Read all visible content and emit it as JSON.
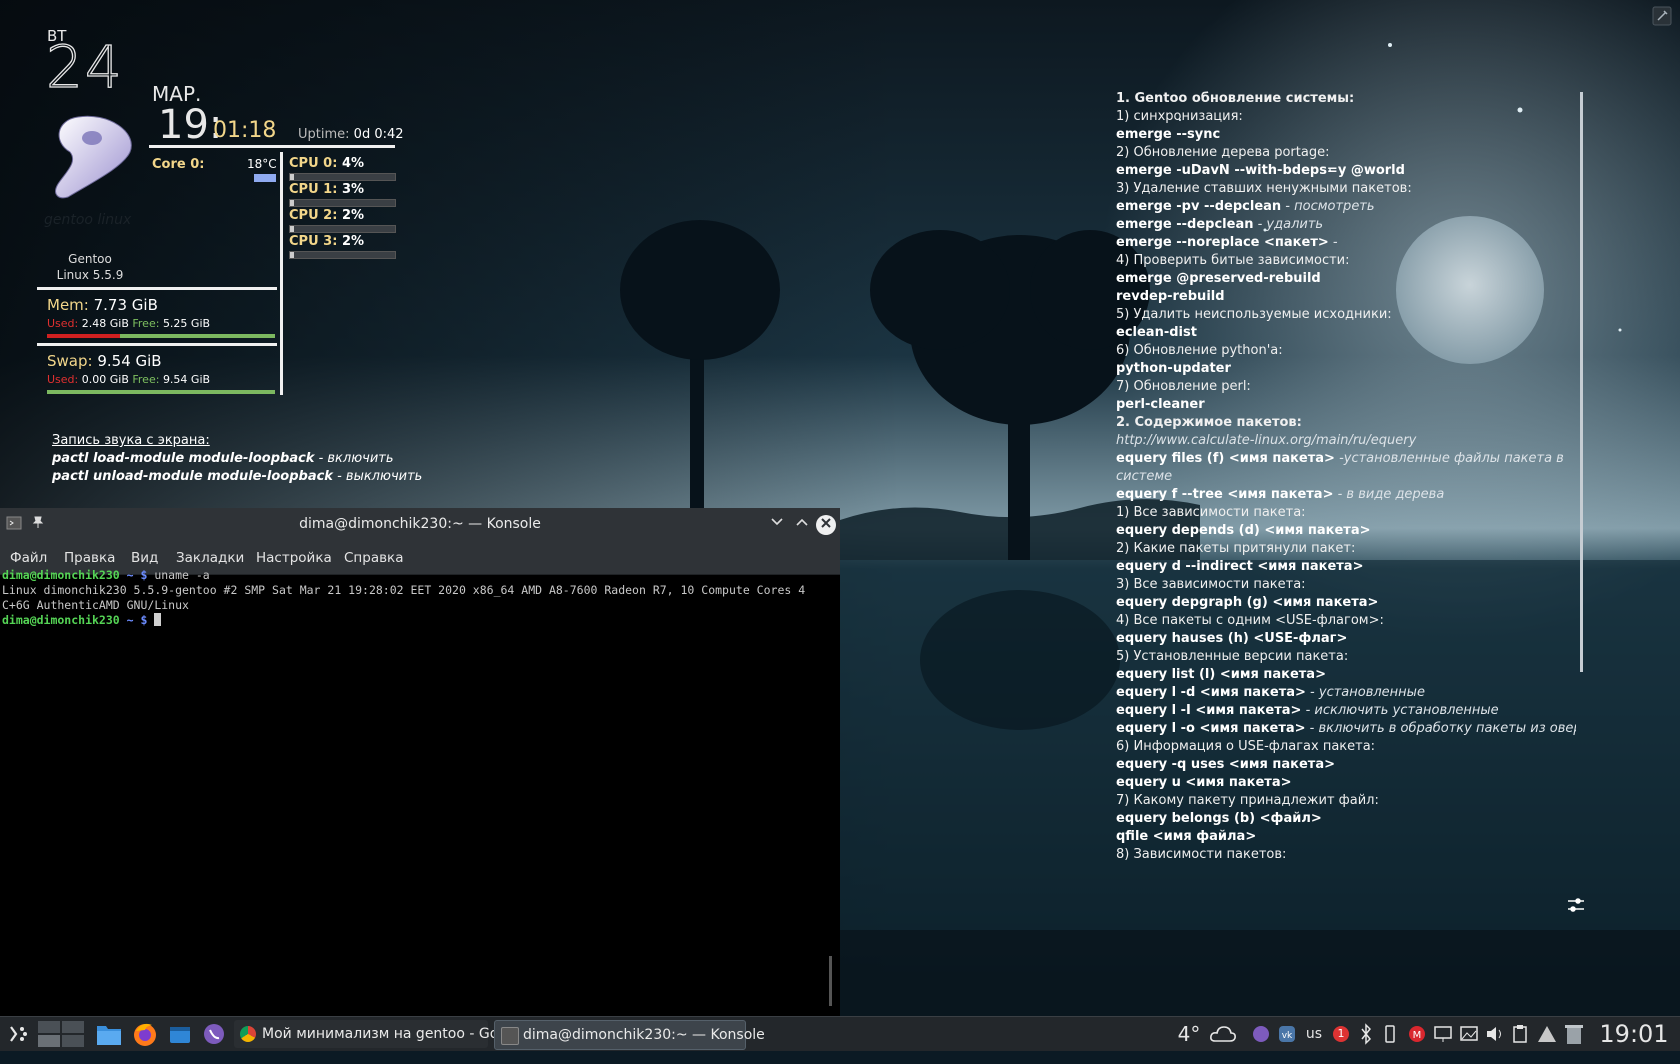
{
  "conky": {
    "day_of_week": "ВТ",
    "day": "24",
    "month": "МАР.",
    "hour": "19:",
    "min_sec": "01:18",
    "uptime_label": "Uptime:",
    "uptime_value": "0d 0:42",
    "core_label": "Core 0:",
    "core_temp": "18°C",
    "cpus": [
      {
        "label": "CPU 0:",
        "value": "4%",
        "fraction": 0.04
      },
      {
        "label": "CPU 1:",
        "value": "3%",
        "fraction": 0.03
      },
      {
        "label": "CPU 2:",
        "value": "2%",
        "fraction": 0.02
      },
      {
        "label": "CPU 3:",
        "value": "2%",
        "fraction": 0.02
      }
    ],
    "logo_text": "gentoo linux",
    "os_name": "Gentoo",
    "kernel": "Linux 5.5.9",
    "mem": {
      "label": "Mem:",
      "total": "7.73 GiB",
      "used_label": "Used:",
      "used": "2.48 GiB",
      "free_label": "Free:",
      "free": "5.25 GiB",
      "used_fraction": 0.32
    },
    "swap": {
      "label": "Swap:",
      "total": "9.54 GiB",
      "used_label": "Used:",
      "used": "0.00 GiB",
      "free_label": "Free:",
      "free": "9.54 GiB",
      "used_fraction": 0.0
    },
    "note_title": "Запись звука с экрана:",
    "note_1_cmd": "pactl load-module module-loopback",
    "note_1_desc": " - включить",
    "note_2_cmd": "pactl unload-module module-loopback",
    "note_2_desc": " - выключить"
  },
  "notes_panel": {
    "lines": [
      {
        "t": " 1. Gentoo обновление системы:",
        "s": "h"
      },
      {
        "t": "1) синхронизация:",
        "s": "n"
      },
      {
        "t": "emerge --sync",
        "s": "c"
      },
      {
        "t": "2) Обновление дерева portage:",
        "s": "n"
      },
      {
        "t": "emerge -uDavN --with-bdeps=y @world",
        "s": "c"
      },
      {
        "t": "3) Удаление ставших ненужными пакетов:",
        "s": "n"
      },
      {
        "t": "emerge -pv --depclean",
        "s": "c",
        "d": " - посмотреть"
      },
      {
        "t": "emerge --depclean",
        "s": "c",
        "d": " - удалить"
      },
      {
        "t": "emerge --noreplace <пакет>",
        "s": "c",
        "d": " -"
      },
      {
        "t": "4) Проверить битые зависимости:",
        "s": "n"
      },
      {
        "t": "emerge @preserved-rebuild",
        "s": "c"
      },
      {
        "t": "revdep-rebuild",
        "s": "c"
      },
      {
        "t": "5) Удалить неиспользуемые исходники:",
        "s": "n"
      },
      {
        "t": "eclean-dist",
        "s": "c"
      },
      {
        "t": "6) Обновление python'a:",
        "s": "n"
      },
      {
        "t": "python-updater",
        "s": "c"
      },
      {
        "t": "7) Обновление perl:",
        "s": "n"
      },
      {
        "t": "perl-cleaner",
        "s": "c"
      },
      {
        "t": " ",
        "s": "n"
      },
      {
        "t": "2. Содержимое пакетов:",
        "s": "h"
      },
      {
        "t": "http://www.calculate-linux.org/main/ru/equery",
        "s": "i"
      },
      {
        "t": "equery files (f) <имя пакета>",
        "s": "c",
        "d": " -установленные файлы пакета в"
      },
      {
        "t": "системе",
        "s": "i"
      },
      {
        "t": "equery f --tree <имя пакета>",
        "s": "c",
        "d": " - в виде дерева"
      },
      {
        "t": "1) Все зависимости пакета:",
        "s": "n"
      },
      {
        "t": "equery depends (d) <имя пакета>",
        "s": "c"
      },
      {
        "t": "2) Какие пакеты притянули пакет:",
        "s": "n"
      },
      {
        "t": "equery d --indirect <имя пакета>",
        "s": "c"
      },
      {
        "t": "3) Все зависимости пакета:",
        "s": "n"
      },
      {
        "t": "equery depgraph (g) <имя пакета>",
        "s": "c"
      },
      {
        "t": "4) Все пакеты с одним <USE-флагом>:",
        "s": "n"
      },
      {
        "t": "equery hauses (h) <USE-флаг>",
        "s": "c"
      },
      {
        "t": "5) Установленные версии пакета:",
        "s": "n"
      },
      {
        "t": "equery list (l) <имя пакета>",
        "s": "c"
      },
      {
        "t": "equery l -d <имя пакета>",
        "s": "c",
        "d": " - установленные"
      },
      {
        "t": "equery l -I <имя пакета>",
        "s": "c",
        "d": " - исключить установленные"
      },
      {
        "t": "equery l -o <имя пакета>",
        "s": "c",
        "d": " - включить в обработку пакеты из оверлеев"
      },
      {
        "t": "6) Информация о USE-флагах пакета:",
        "s": "n"
      },
      {
        "t": "equery -q uses <имя пакета>",
        "s": "c"
      },
      {
        "t": "equery u <имя пакета>",
        "s": "c"
      },
      {
        "t": "7) Какому пакету принадлежит файл:",
        "s": "n"
      },
      {
        "t": "equery belongs (b) <файл>",
        "s": "c"
      },
      {
        "t": "qfile <имя файла>",
        "s": "c"
      },
      {
        "t": "8) Зависимости пакетов:",
        "s": "n"
      }
    ]
  },
  "konsole": {
    "title": "dima@dimonchik230:~ — Konsole",
    "menu": [
      "Файл",
      "Правка",
      "Вид",
      "Закладки",
      "Настройка",
      "Справка"
    ],
    "prompt_user": "dima@dimonchik230",
    "prompt_path": " ~ $",
    "command_1": " uname -a",
    "output_1": "Linux dimonchik230 5.5.9-gentoo #2 SMP Sat Mar 21 19:28:02 EET 2020 x86_64 AMD A8-7600 Radeon R7, 10 Compute Cores 4",
    "output_2": "C+6G AuthenticAMD GNU/Linux"
  },
  "taskbar": {
    "tasks": [
      {
        "label": "Мой минимализм на gentoo - Go..."
      },
      {
        "label": "dima@dimonchik230:~ — Konsole"
      }
    ],
    "weather_temp": "4°",
    "keyboard_layout": "us",
    "notification_count": "1",
    "clock": "19:01"
  }
}
